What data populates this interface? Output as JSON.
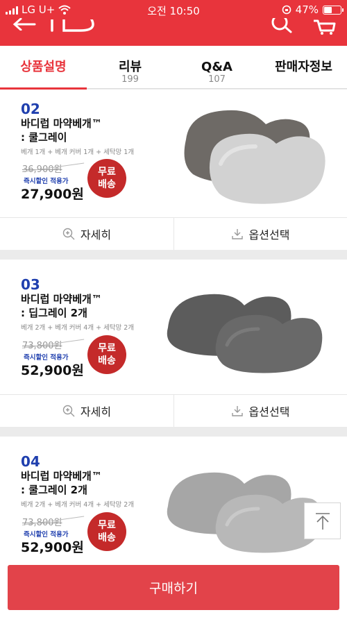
{
  "status": {
    "carrier": "LG U+",
    "time": "오전 10:50",
    "battery": "47%"
  },
  "colors": {
    "brand": "#e8343c",
    "number": "#1f3fae",
    "badge": "#c42a2a"
  },
  "tabs": [
    {
      "label": "상품설명",
      "count": "",
      "active": true
    },
    {
      "label": "리뷰",
      "count": "199"
    },
    {
      "label": "Q&A",
      "count": "107"
    },
    {
      "label": "판매자정보",
      "count": ""
    }
  ],
  "products": [
    {
      "number": "02",
      "name_line1": "바디럽 마약베개™",
      "name_line2": ": 쿨그레이",
      "desc": "베개 1개 + 베개 커버 1개 + 세탁망 1개",
      "original_price": "36,900원",
      "discount_label": "즉시할인 적용가",
      "price": "27,900원",
      "badge_line1": "무료",
      "badge_line2": "배송",
      "detail_label": "자세히",
      "option_label": "옵션선택"
    },
    {
      "number": "03",
      "name_line1": "바디럽 마약베개™",
      "name_line2": ": 딥그레이 2개",
      "desc": "베개 2개 + 베개 커버 4개 + 세탁망 2개",
      "original_price": "73,800원",
      "discount_label": "즉시할인 적용가",
      "price": "52,900원",
      "badge_line1": "무료",
      "badge_line2": "배송",
      "detail_label": "자세히",
      "option_label": "옵션선택"
    },
    {
      "number": "04",
      "name_line1": "바디럽 마약베개™",
      "name_line2": ": 쿨그레이 2개",
      "desc": "베개 2개 + 베개 커버 4개 + 세탁망 2개",
      "original_price": "73,800원",
      "discount_label": "즉시할인 적용가",
      "price": "52,900원",
      "badge_line1": "무료",
      "badge_line2": "배송"
    }
  ],
  "buy_button": "구매하기"
}
